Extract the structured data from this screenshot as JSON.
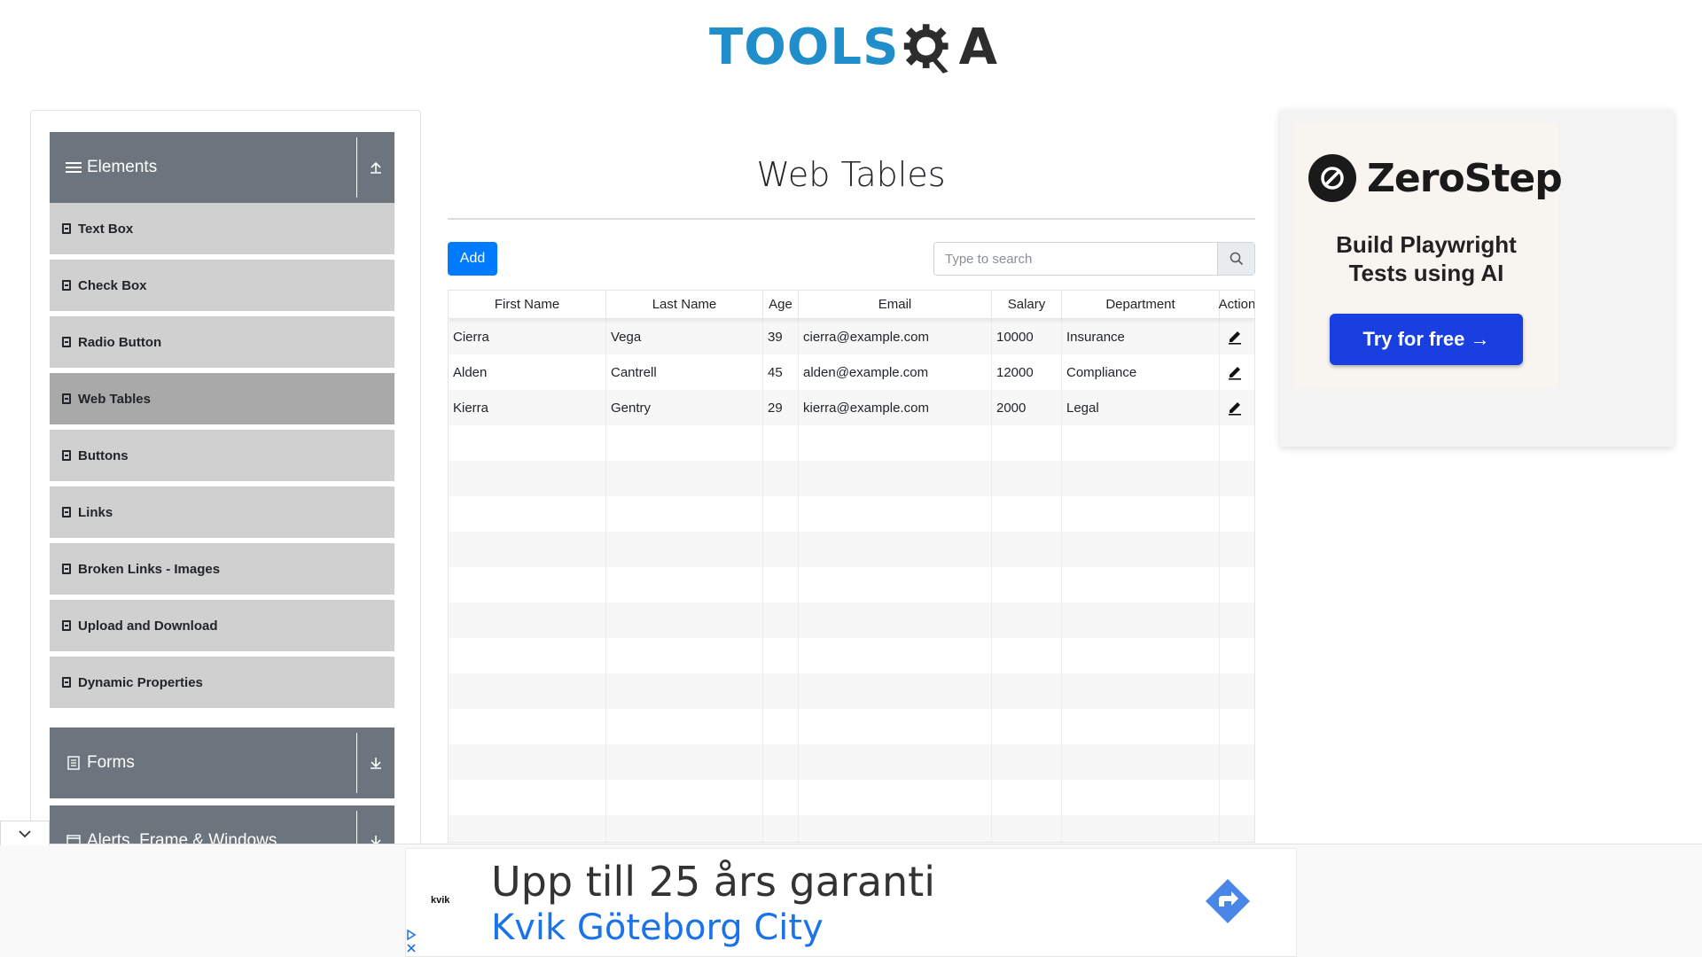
{
  "logo": {
    "left": "TOOLS",
    "right": "A"
  },
  "sidebar": {
    "groups": [
      {
        "label": "Elements",
        "icon": "menu-icon",
        "toggle": "collapse-up-icon"
      },
      {
        "label": "Forms",
        "icon": "form-icon",
        "toggle": "expand-down-icon"
      },
      {
        "label": "Alerts, Frame & Windows",
        "icon": "window-icon",
        "toggle": "expand-down-icon"
      }
    ],
    "items": [
      {
        "label": "Text Box"
      },
      {
        "label": "Check Box"
      },
      {
        "label": "Radio Button"
      },
      {
        "label": "Web Tables",
        "active": true
      },
      {
        "label": "Buttons"
      },
      {
        "label": "Links"
      },
      {
        "label": "Broken Links - Images"
      },
      {
        "label": "Upload and Download"
      },
      {
        "label": "Dynamic Properties"
      }
    ]
  },
  "main": {
    "title": "Web Tables",
    "add_label": "Add",
    "search_placeholder": "Type to search"
  },
  "table": {
    "columns": [
      "First Name",
      "Last Name",
      "Age",
      "Email",
      "Salary",
      "Department",
      "Action"
    ],
    "rows": [
      [
        "Cierra",
        "Vega",
        "39",
        "cierra@example.com",
        "10000",
        "Insurance"
      ],
      [
        "Alden",
        "Cantrell",
        "45",
        "alden@example.com",
        "12000",
        "Compliance"
      ],
      [
        "Kierra",
        "Gentry",
        "29",
        "kierra@example.com",
        "2000",
        "Legal"
      ]
    ],
    "total_rows_shown": 15
  },
  "side_ad": {
    "brand": "ZeroStep",
    "tagline_1": "Build Playwright",
    "tagline_2": "Tests using AI",
    "cta": "Try for free →"
  },
  "bottom_ad": {
    "logo": "kvik",
    "headline": "Upp till 25 års garanti",
    "subline": "Kvik Göteborg City"
  },
  "colors": {
    "accent": "#007bff",
    "sidebar_header": "#6c757d",
    "menu_item": "#d0d0d0",
    "menu_active": "#a9a9a9",
    "cta": "#1a3fe0",
    "logo_blue": "#1f8ecb"
  }
}
